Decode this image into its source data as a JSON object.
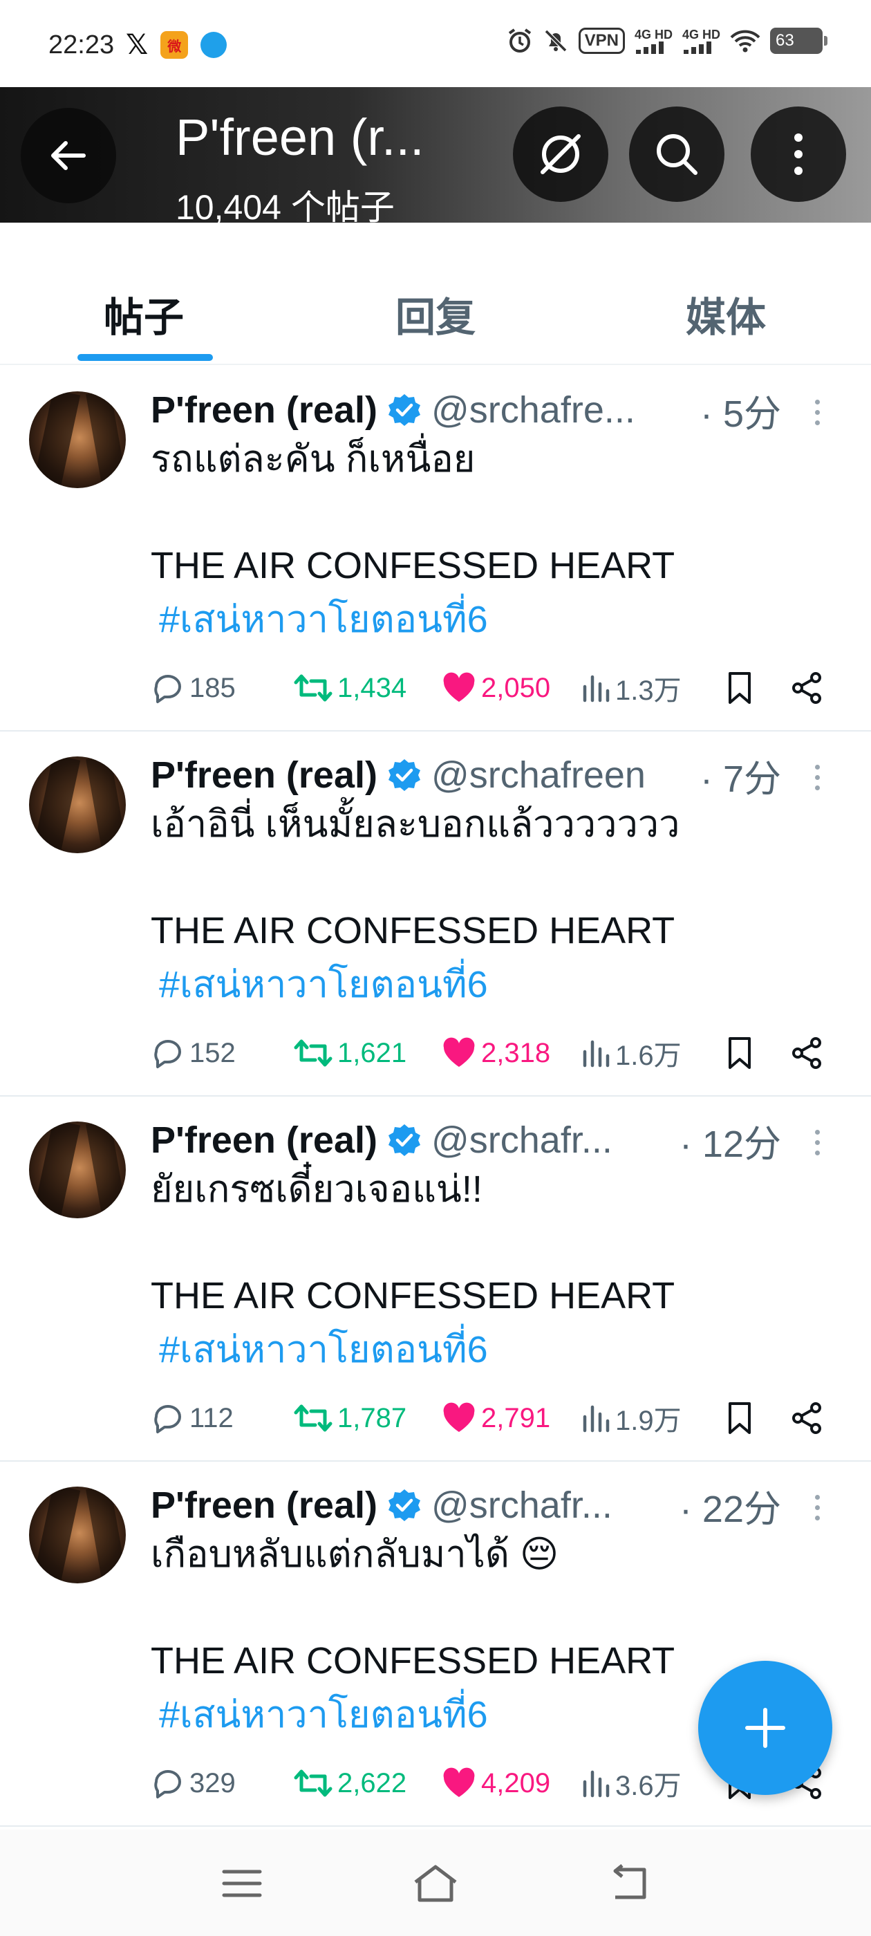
{
  "status_bar": {
    "time": "22:23",
    "x_icon": "𝕏",
    "weibo_icon": "微",
    "vpn": "VPN",
    "signal1": "4G HD",
    "signal2": "4G HD",
    "battery": "63"
  },
  "header": {
    "title": "P'freen (r...",
    "subtitle": "10,404 个帖子",
    "back_icon": "arrow-left-icon",
    "translate_icon": "translate-off-icon",
    "search_icon": "search-icon",
    "more_icon": "more-vertical-icon"
  },
  "tabs": [
    {
      "label": "帖子",
      "active": true
    },
    {
      "label": "回复",
      "active": false
    },
    {
      "label": "媒体",
      "active": false
    }
  ],
  "colors": {
    "accent": "#1d9bf0",
    "retweet": "#00ba7c",
    "like": "#f91880",
    "muted": "#536471"
  },
  "tweets": [
    {
      "name": "P'freen (real)",
      "handle": "@srchafre...",
      "time": "· 5分",
      "text": "รถแต่ละคัน ก็เหนื่อย",
      "text2": "THE AIR CONFESSED HEART",
      "hashtag": "#เสน่หาวาโยตอนที่6",
      "replies": "185",
      "retweets": "1,434",
      "likes": "2,050",
      "views": "1.3万"
    },
    {
      "name": "P'freen (real)",
      "handle": "@srchafreen",
      "time": "· 7分",
      "text": "เอ้าอินี่ เห็นมั้ยละบอกแล้ววววววว",
      "text2": "THE AIR CONFESSED HEART",
      "hashtag": "#เสน่หาวาโยตอนที่6",
      "replies": "152",
      "retweets": "1,621",
      "likes": "2,318",
      "views": "1.6万"
    },
    {
      "name": "P'freen (real)",
      "handle": "@srchafr...",
      "time": "· 12分",
      "text": "ยัยเกรซเดี๋ยวเจอแน่!!",
      "text2": "THE AIR CONFESSED HEART",
      "hashtag": "#เสน่หาวาโยตอนที่6",
      "replies": "112",
      "retweets": "1,787",
      "likes": "2,791",
      "views": "1.9万"
    },
    {
      "name": "P'freen (real)",
      "handle": "@srchafr...",
      "time": "· 22分",
      "text": "เกือบหลับแต่กลับมาได้ 😔",
      "text2": "THE AIR CONFESSED HEART",
      "hashtag": "#เสน่หาวาโยตอนที่6",
      "replies": "329",
      "retweets": "2,622",
      "likes": "4,209",
      "views": "3.6万"
    }
  ],
  "fab": {
    "icon": "plus-icon"
  },
  "nav": {
    "menu_icon": "menu-icon",
    "home_icon": "home-icon",
    "back_icon": "back-icon"
  }
}
